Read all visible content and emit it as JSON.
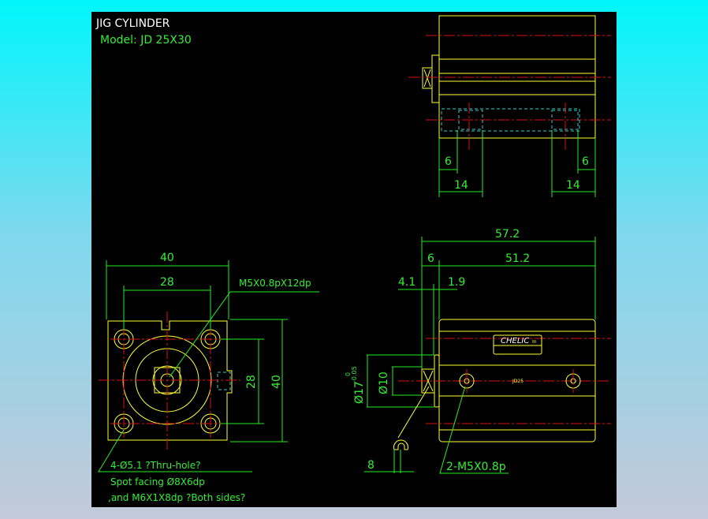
{
  "title": "JIG CYLINDER",
  "model": "Model:  JD 25X30",
  "top_view": {
    "dim_left_6": "6",
    "dim_right_6": "6",
    "dim_left_14": "14",
    "dim_right_14": "14"
  },
  "front_view": {
    "width_outer": "40",
    "width_inner": "28",
    "height_inner": "28",
    "height_outer": "40",
    "tap_callout": "M5X0.8pX12dp"
  },
  "notes": {
    "hole": "4-Ø5.1 ?Thru-hole?",
    "spot": "Spot facing  Ø8X6dp",
    "tap": ",and M6X1X8dp ?Both sides?"
  },
  "side_view": {
    "overall": "57.2",
    "rod_ext": "6",
    "body": "51.2",
    "d41": "4.1",
    "d19": "1.9",
    "rod_dia": "Ø10",
    "boss_dia": "Ø17",
    "boss_tol_upper": "0",
    "boss_tol_lower": "-0.05",
    "wrench": "8",
    "port": "2-M5X0.8p",
    "label_brand": "CHELIC",
    "label_suffix": "In",
    "body_mark": "JD25"
  },
  "colors": {
    "background": "#000000",
    "outline": "#ffff33",
    "dimension": "#22ee22",
    "centerline": "#dd1111",
    "hidden": "#33cccc"
  }
}
